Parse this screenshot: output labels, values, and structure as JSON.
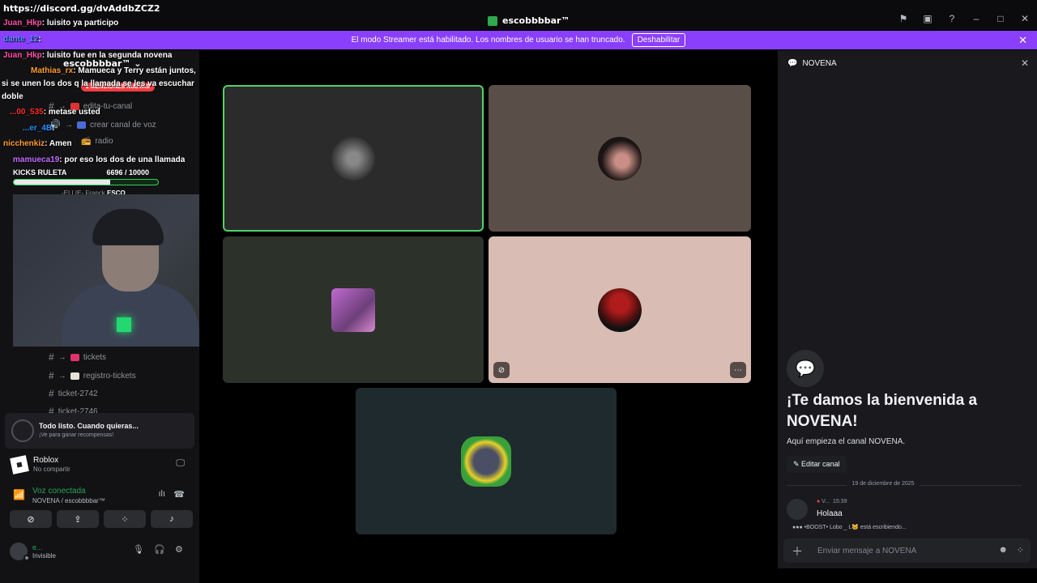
{
  "titlebar": {
    "url": "https://discord.gg/dvAddbZCZ2",
    "server_title": "escobbbbar™",
    "icons": [
      "flag-icon",
      "inbox-icon",
      "help-icon",
      "minimize-icon",
      "maximize-icon",
      "close-icon"
    ]
  },
  "banner": {
    "text": "El modo Streamer está habilitado. Los nombres de usuario se han truncado.",
    "button": "Deshabilitar",
    "color": "#8a3ffc"
  },
  "sidebar": {
    "server_name": "escobbbbar™",
    "mentions_pill": "2 MENCIONES NUEVAS",
    "channels": [
      {
        "label": "edita-tu-canal"
      },
      {
        "label": "crear canal de voz"
      },
      {
        "label": "radio"
      },
      {
        "label": "tickets"
      },
      {
        "label": "registro-tickets"
      },
      {
        "label": "ticket-2742"
      },
      {
        "label": "ticket-2746"
      }
    ]
  },
  "chat_overlay": {
    "lines": [
      {
        "user": "Juan_Hkp",
        "text": ": luisito ya participo",
        "color": "#ff4ea6"
      },
      {
        "user": "dante_12",
        "text": ":",
        "color": "#4e8cff"
      },
      {
        "user": "Juan_Hkp",
        "text": ": luisito fue en la segunda novena",
        "color": "#ff4ea6"
      },
      {
        "user": "Mathias_rx",
        "text": ": Mamueca y Terry están juntos,",
        "color": "#ff9b2f"
      },
      {
        "user": "",
        "text": "si se unen los dos q la llamada se les va escuchar",
        "color": "#ffffff"
      },
      {
        "user": "",
        "text": "doble",
        "color": "#ffffff"
      },
      {
        "user": "...00_535",
        "text": ": metase usted",
        "color": "#ff2b2b"
      },
      {
        "user": "...er_4B",
        "text": ":",
        "color": "#2b8cff"
      },
      {
        "user": "nicchenkiz",
        "text": ": Amen",
        "color": "#ff9b2f"
      },
      {
        "user": "mamueca19",
        "text": ": por eso los dos de una llamada",
        "color": "#c46bff"
      }
    ],
    "kicks": {
      "label": "KICKS RULETA",
      "value": "6696 / 10000",
      "progress": 0.6696
    },
    "voice_member": "-ELLIE- Franck",
    "voice_member_tag": "ESCO"
  },
  "activity": {
    "title": "Todo listo. Cuando quieras...",
    "subtitle": "¡Ve para ganar recompensas!"
  },
  "roblox": {
    "name": "Roblox",
    "status": "No compartir"
  },
  "voice": {
    "status": "Voz conectada",
    "channel": "NOVENA / escobbbbar™"
  },
  "user": {
    "name": "e...",
    "status": "Invisible"
  },
  "stage": {
    "tiles": [
      {
        "name": "tile-1",
        "bg": "#2b2b2b",
        "border": "#4fd36a",
        "avatar": "#6a6a6a"
      },
      {
        "name": "tile-2",
        "bg": "#5a4f48",
        "avatar": "#2a2020"
      },
      {
        "name": "tile-3",
        "bg": "#2c3129",
        "avatar": "#c06ad0"
      },
      {
        "name": "tile-4",
        "bg": "#d9bcb3",
        "avatar": "#b01c1c"
      },
      {
        "name": "tile-5",
        "bg": "#1f2a2e",
        "avatar": "#3aa03a"
      }
    ]
  },
  "right_panel": {
    "title": "NOVENA",
    "welcome_title": "¡Te damos la bienvenida a NOVENA!",
    "welcome_sub": "Aquí empieza el canal NOVENA.",
    "edit_button": "Editar canal",
    "date": "19 de diciembre de 2025",
    "message": {
      "author": "V...",
      "time": "15:39",
      "text": "Holaaa"
    },
    "typing": "•BOOST• Lobo _ L🐱 está escribiendo...",
    "composer_placeholder": "Enviar mensaje a NOVENA"
  }
}
